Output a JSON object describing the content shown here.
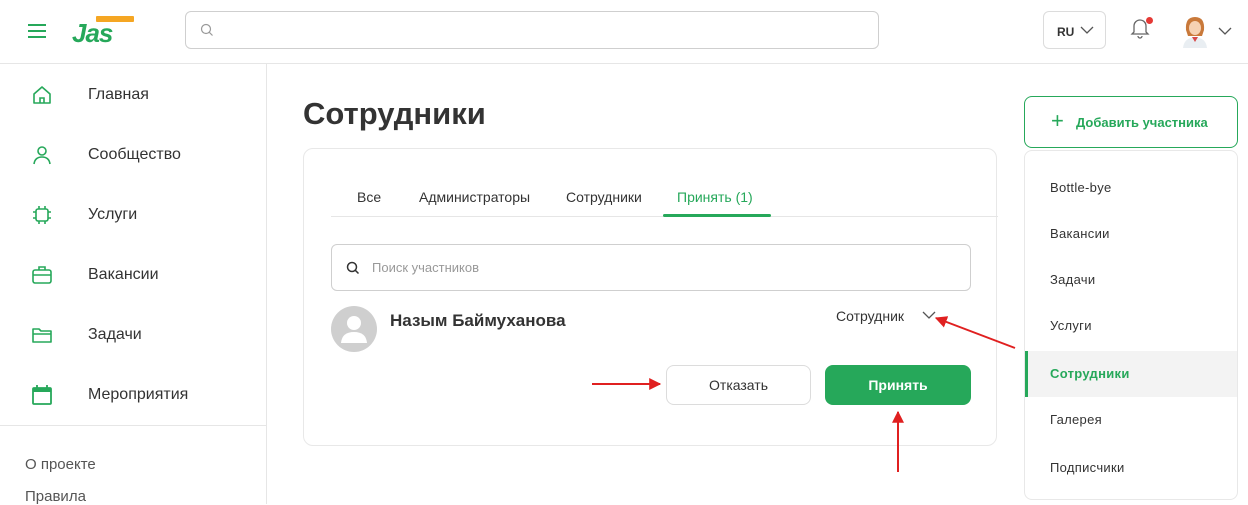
{
  "header": {
    "search_placeholder": "",
    "language": "RU",
    "logo_text": "Jas"
  },
  "sidebar": {
    "items": [
      {
        "label": "Главная",
        "icon": "home-icon"
      },
      {
        "label": "Сообщество",
        "icon": "user-icon"
      },
      {
        "label": "Услуги",
        "icon": "services-icon"
      },
      {
        "label": "Вакансии",
        "icon": "briefcase-icon"
      },
      {
        "label": "Задачи",
        "icon": "folder-icon"
      },
      {
        "label": "Мероприятия",
        "icon": "calendar-icon"
      }
    ],
    "links": [
      "О проекте",
      "Правила"
    ]
  },
  "main": {
    "title": "Сотрудники",
    "tabs": [
      "Все",
      "Администраторы",
      "Сотрудники",
      "Принять (1)"
    ],
    "active_tab": "Принять (1)",
    "search_placeholder": "Поиск участников",
    "member": {
      "name": "Назым Баймуханова",
      "role": "Сотрудник"
    },
    "reject_label": "Отказать",
    "accept_label": "Принять"
  },
  "right_panel": {
    "add_button_label": "Добавить участника",
    "menu": [
      "Bottle-bye",
      "Вакансии",
      "Задачи",
      "Услуги",
      "Сотрудники",
      "Галерея",
      "Подписчики"
    ],
    "active_menu": "Сотрудники"
  },
  "colors": {
    "accent": "#26a85a",
    "annotation_arrow": "#e02020",
    "notification_dot": "#e53935"
  }
}
